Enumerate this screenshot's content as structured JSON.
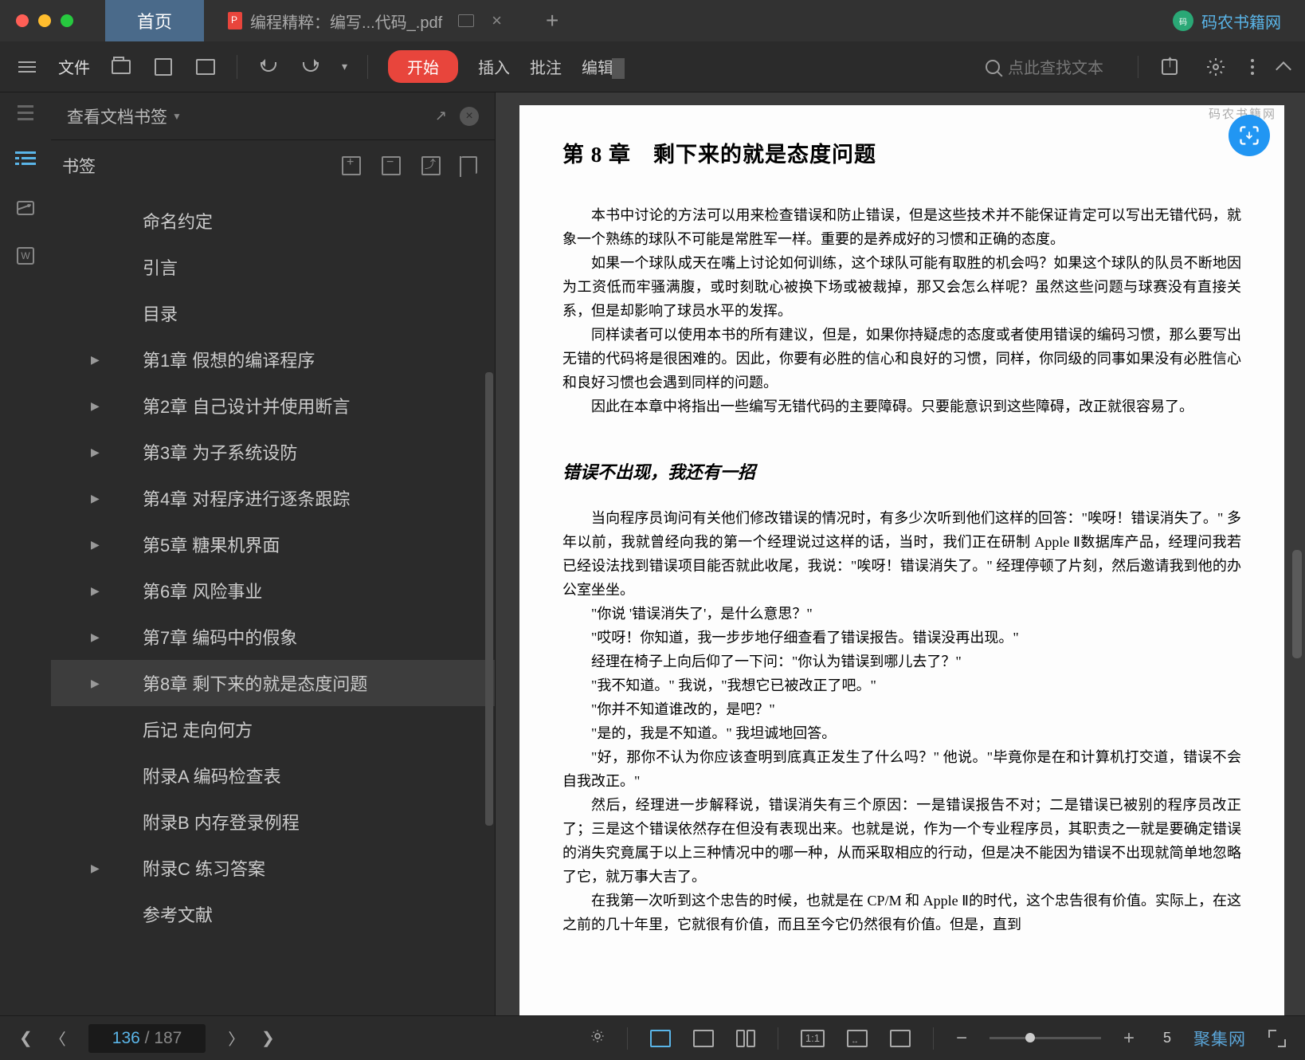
{
  "tabs": {
    "home": "首页",
    "file": "编程精粹：编写...代码_.pdf"
  },
  "brand": "码农书籍网",
  "toolbar": {
    "file": "文件",
    "start": "开始",
    "insert": "插入",
    "annotate": "批注",
    "edit": "编辑",
    "search_placeholder": "点此查找文本"
  },
  "sidebar": {
    "title": "查看文档书签",
    "tab": "书签",
    "items": [
      {
        "label": "命名约定",
        "lvl": 2,
        "children": false
      },
      {
        "label": "引言",
        "lvl": 2,
        "children": false
      },
      {
        "label": "目录",
        "lvl": 2,
        "children": false
      },
      {
        "label": "第1章  假想的编译程序",
        "lvl": 2,
        "children": true
      },
      {
        "label": "第2章  自己设计并使用断言",
        "lvl": 2,
        "children": true
      },
      {
        "label": "第3章  为子系统设防",
        "lvl": 2,
        "children": true
      },
      {
        "label": "第4章  对程序进行逐条跟踪",
        "lvl": 2,
        "children": true
      },
      {
        "label": "第5章  糖果机界面",
        "lvl": 2,
        "children": true
      },
      {
        "label": "第6章  风险事业",
        "lvl": 2,
        "children": true
      },
      {
        "label": "第7章  编码中的假象",
        "lvl": 2,
        "children": true
      },
      {
        "label": "第8章  剩下来的就是态度问题",
        "lvl": 2,
        "children": true,
        "selected": true
      },
      {
        "label": "后记  走向何方",
        "lvl": 2,
        "children": false
      },
      {
        "label": "附录A  编码检查表",
        "lvl": 2,
        "children": false
      },
      {
        "label": "附录B  内存登录例程",
        "lvl": 2,
        "children": false
      },
      {
        "label": "附录C  练习答案",
        "lvl": 2,
        "children": true
      },
      {
        "label": "参考文献",
        "lvl": 2,
        "children": false
      }
    ]
  },
  "page": {
    "chapter_num": "第 8 章",
    "chapter_title": "剩下来的就是态度问题",
    "p1": "本书中讨论的方法可以用来检查错误和防止错误，但是这些技术并不能保证肯定可以写出无错代码，就象一个熟练的球队不可能是常胜军一样。重要的是养成好的习惯和正确的态度。",
    "p2": "如果一个球队成天在嘴上讨论如何训练，这个球队可能有取胜的机会吗？如果这个球队的队员不断地因为工资低而牢骚满腹，或时刻耽心被换下场或被裁掉，那又会怎么样呢？虽然这些问题与球赛没有直接关系，但是却影响了球员水平的发挥。",
    "p3": "同样读者可以使用本书的所有建议，但是，如果你持疑虑的态度或者使用错误的编码习惯，那么要写出无错的代码将是很困难的。因此，你要有必胜的信心和良好的习惯，同样，你同级的同事如果没有必胜信心和良好习惯也会遇到同样的问题。",
    "p4": "因此在本章中将指出一些编写无错代码的主要障碍。只要能意识到这些障碍，改正就很容易了。",
    "h2": "错误不出现，我还有一招",
    "p5": "当向程序员询问有关他们修改错误的情况时，有多少次听到他们这样的回答：\"唉呀！错误消失了。\" 多年以前，我就曾经向我的第一个经理说过这样的话，当时，我们正在研制 Apple Ⅱ数据库产品，经理问我若已经设法找到错误项目能否就此收尾，我说：\"唉呀！错误消失了。\" 经理停顿了片刻，然后邀请我到他的办公室坐坐。",
    "q1": "\"你说 '错误消失了'，是什么意思？\"",
    "q2": "\"哎呀！你知道，我一步步地仔细查看了错误报告。错误没再出现。\"",
    "q3": "经理在椅子上向后仰了一下问：\"你认为错误到哪儿去了？\"",
    "q4": "\"我不知道。\" 我说，\"我想它已被改正了吧。\"",
    "q5": "\"你并不知道谁改的，是吧？\"",
    "q6": "\"是的，我是不知道。\" 我坦诚地回答。",
    "q7": "\"好，那你不认为你应该查明到底真正发生了什么吗？\" 他说。\"毕竟你是在和计算机打交道，错误不会自我改正。\"",
    "p6": "然后，经理进一步解释说，错误消失有三个原因：一是错误报告不对；二是错误已被别的程序员改正了；三是这个错误依然存在但没有表现出来。也就是说，作为一个专业程序员，其职责之一就是要确定错误的消失究竟属于以上三种情况中的哪一种，从而采取相应的行动，但是决不能因为错误不出现就简单地忽略了它，就万事大吉了。",
    "p7": "在我第一次听到这个忠告的时候，也就是在 CP/M 和 Apple Ⅱ的时代，这个忠告很有价值。实际上，在这之前的几十年里，它就很有价值，而且至今它仍然很有价值。但是，直到",
    "watermark_tr": "码农书籍网"
  },
  "status": {
    "page_current": "136",
    "page_total": "187",
    "ratio1": "1:1",
    "zoom": "5",
    "watermark": "聚集网"
  }
}
